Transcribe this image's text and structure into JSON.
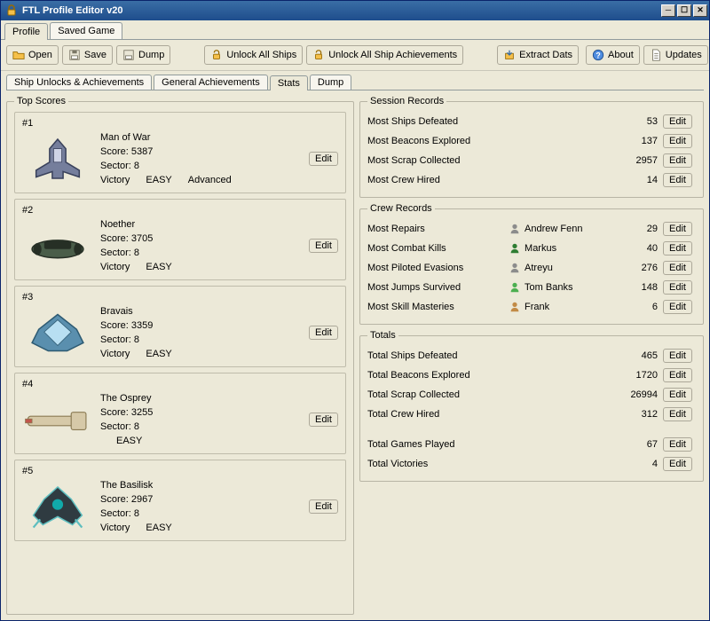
{
  "window": {
    "title": "FTL Profile Editor v20",
    "buttons": {
      "min": "─",
      "max": "☐",
      "close": "✕"
    }
  },
  "primaryTabs": [
    {
      "label": "Profile",
      "active": true
    },
    {
      "label": "Saved Game",
      "active": false
    }
  ],
  "toolbar": {
    "open": "Open",
    "save": "Save",
    "dump": "Dump",
    "unlockShips": "Unlock All Ships",
    "unlockAchievements": "Unlock All Ship Achievements",
    "extractDats": "Extract Dats",
    "about": "About",
    "updates": "Updates"
  },
  "subTabs": [
    {
      "label": "Ship Unlocks & Achievements",
      "active": false
    },
    {
      "label": "General Achievements",
      "active": false
    },
    {
      "label": "Stats",
      "active": true
    },
    {
      "label": "Dump",
      "active": false
    }
  ],
  "labels": {
    "topScores": "Top Scores",
    "sessionRecords": "Session Records",
    "crewRecords": "Crew Records",
    "totals": "Totals",
    "edit": "Edit",
    "scorePrefix": "Score: ",
    "sectorPrefix": "Sector: "
  },
  "topScores": [
    {
      "rank": "#1",
      "ship": "Man of War",
      "score": "5387",
      "sector": "8",
      "tags": [
        "Victory",
        "EASY",
        "Advanced"
      ],
      "shipFill": "#757e9c",
      "shipStroke": "#39415b",
      "shipType": "kestrel"
    },
    {
      "rank": "#2",
      "ship": "Noether",
      "score": "3705",
      "sector": "8",
      "tags": [
        "Victory",
        "EASY"
      ],
      "shipFill": "#4a5d49",
      "shipStroke": "#262f25",
      "shipType": "flat"
    },
    {
      "rank": "#3",
      "ship": "Bravais",
      "score": "3359",
      "sector": "8",
      "tags": [
        "Victory",
        "EASY"
      ],
      "shipFill": "#5a8fae",
      "shipStroke": "#2d5a72",
      "shipType": "crystal"
    },
    {
      "rank": "#4",
      "ship": "The Osprey",
      "score": "3255",
      "sector": "8",
      "tags": [
        "",
        "EASY"
      ],
      "shipFill": "#d6c9a8",
      "shipStroke": "#8a7a53",
      "shipType": "long"
    },
    {
      "rank": "#5",
      "ship": "The Basilisk",
      "score": "2967",
      "sector": "8",
      "tags": [
        "Victory",
        "EASY"
      ],
      "shipFill": "#2f3b41",
      "shipStroke": "#5ebebf",
      "shipType": "mantis"
    }
  ],
  "sessionRecords": [
    {
      "label": "Most Ships Defeated",
      "value": "53"
    },
    {
      "label": "Most Beacons Explored",
      "value": "137"
    },
    {
      "label": "Most Scrap Collected",
      "value": "2957"
    },
    {
      "label": "Most Crew Hired",
      "value": "14"
    }
  ],
  "crewRecords": [
    {
      "label": "Most Repairs",
      "who": "Andrew Fenn",
      "value": "29",
      "iconColor": "#8c8c8c"
    },
    {
      "label": "Most Combat Kills",
      "who": "Markus",
      "value": "40",
      "iconColor": "#2e7d32"
    },
    {
      "label": "Most Piloted Evasions",
      "who": "Atreyu",
      "value": "276",
      "iconColor": "#8c8c8c"
    },
    {
      "label": "Most Jumps Survived",
      "who": "Tom Banks",
      "value": "148",
      "iconColor": "#4caf50"
    },
    {
      "label": "Most Skill Masteries",
      "who": "Frank",
      "value": "6",
      "iconColor": "#c28b46"
    }
  ],
  "totals": [
    {
      "label": "Total Ships Defeated",
      "value": "465"
    },
    {
      "label": "Total Beacons Explored",
      "value": "1720"
    },
    {
      "label": "Total Scrap Collected",
      "value": "26994"
    },
    {
      "label": "Total Crew Hired",
      "value": "312"
    }
  ],
  "totalsBottom": [
    {
      "label": "Total Games Played",
      "value": "67"
    },
    {
      "label": "Total Victories",
      "value": "4"
    }
  ]
}
